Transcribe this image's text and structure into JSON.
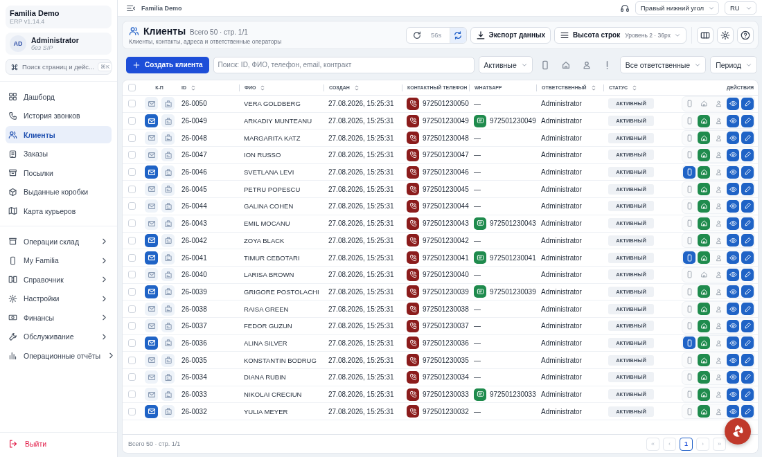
{
  "app": {
    "name": "Familia Demo",
    "version": "ERP v1.14.4"
  },
  "user": {
    "initials": "AD",
    "name": "Administrator",
    "sip": "без SIP"
  },
  "command_search": {
    "placeholder": "Поиск страниц и дейс...",
    "shortcut": "⌘K"
  },
  "nav": [
    {
      "label": "Дашборд",
      "selected": false
    },
    {
      "label": "История звонков",
      "selected": false
    },
    {
      "label": "Клиенты",
      "selected": true
    },
    {
      "label": "Заказы",
      "selected": false
    },
    {
      "label": "Посылки",
      "selected": false
    },
    {
      "label": "Выданные коробки",
      "selected": false
    },
    {
      "label": "Карта курьеров",
      "selected": false
    }
  ],
  "nav_groups": [
    {
      "label": "Операции склад",
      "expanded": false
    },
    {
      "label": "My Familia",
      "expanded": false
    },
    {
      "label": "Справочник",
      "expanded": false
    },
    {
      "label": "Настройки",
      "expanded": false
    },
    {
      "label": "Финансы",
      "expanded": false
    },
    {
      "label": "Обслуживание",
      "expanded": false
    },
    {
      "label": "Операционные отчёты",
      "expanded": false
    }
  ],
  "logout": "Выйти",
  "topbar": {
    "breadcrumb": "Familia Demo",
    "position_select": "Правый нижний угол",
    "language_select": "RU"
  },
  "header": {
    "title": "Клиенты",
    "count": "Всего 50 · стр. 1/1",
    "subtitle": "Клиенты, контакты, адреса и ответственные операторы",
    "refresh_timer": "56s",
    "auto_refresh": true,
    "export": "Экспорт данных",
    "row_height_label": "Высота строк",
    "row_height_value": "Уровень 2 · 36px"
  },
  "toolbar": {
    "create": "Создать клиента",
    "search": {
      "placeholder": "Поиск: ID, ФИО, телефон, email, контракт"
    },
    "status_filter": "Активные",
    "filters": [
      {
        "kind": "mobile",
        "on": false
      },
      {
        "kind": "home",
        "on": false
      },
      {
        "kind": "person",
        "on": false
      },
      {
        "kind": "alert",
        "on": false
      }
    ],
    "responsible_filter": "Все ответственные",
    "period": "Период"
  },
  "table": {
    "all_checked": false,
    "columns": [
      {
        "label": "К-П",
        "sortable": false
      },
      {
        "label": "ID",
        "sortable": true
      },
      {
        "label": "ФИО",
        "sortable": true
      },
      {
        "label": "СОЗДАН",
        "sortable": true
      },
      {
        "label": "КОНТАКТНЫЙ ТЕЛЕФОН",
        "sortable": false
      },
      {
        "label": "WHATSAPP",
        "sortable": false
      },
      {
        "label": "ОТВЕТСТВЕННЫЙ",
        "sortable": true
      },
      {
        "label": "СТАТУС",
        "sortable": true
      },
      {
        "label": "ДЕЙСТВИЯ",
        "sortable": false
      }
    ],
    "rows": [
      {
        "checked": false,
        "email": false,
        "id": "26-0050",
        "name": "VERA GOLDBERG",
        "created": "27.08.2026, 15:25:31",
        "phone": "972501230050",
        "whatsapp": {
          "kind": "none",
          "text": "—"
        },
        "responsible": "Administrator",
        "status": "АКТИВНЫЙ",
        "mobile_app": false,
        "home": false
      },
      {
        "checked": false,
        "email": true,
        "id": "26-0049",
        "name": "ARKADIY MUNTEANU",
        "created": "27.08.2026, 15:25:31",
        "phone": "972501230049",
        "whatsapp": {
          "kind": "number",
          "text": "972501230049"
        },
        "responsible": "Administrator",
        "status": "АКТИВНЫЙ",
        "mobile_app": false,
        "home": true
      },
      {
        "checked": false,
        "email": false,
        "id": "26-0048",
        "name": "MARGARITA KATZ",
        "created": "27.08.2026, 15:25:31",
        "phone": "972501230048",
        "whatsapp": {
          "kind": "none",
          "text": "—"
        },
        "responsible": "Administrator",
        "status": "АКТИВНЫЙ",
        "mobile_app": false,
        "home": true
      },
      {
        "checked": false,
        "email": false,
        "id": "26-0047",
        "name": "ION RUSSO",
        "created": "27.08.2026, 15:25:31",
        "phone": "972501230047",
        "whatsapp": {
          "kind": "none",
          "text": "—"
        },
        "responsible": "Administrator",
        "status": "АКТИВНЫЙ",
        "mobile_app": false,
        "home": true
      },
      {
        "checked": false,
        "email": true,
        "id": "26-0046",
        "name": "SVETLANA LEVI",
        "created": "27.08.2026, 15:25:31",
        "phone": "972501230046",
        "whatsapp": {
          "kind": "none",
          "text": "—"
        },
        "responsible": "Administrator",
        "status": "АКТИВНЫЙ",
        "mobile_app": true,
        "home": true
      },
      {
        "checked": false,
        "email": false,
        "id": "26-0045",
        "name": "PETRU POPESCU",
        "created": "27.08.2026, 15:25:31",
        "phone": "972501230045",
        "whatsapp": {
          "kind": "none",
          "text": "—"
        },
        "responsible": "Administrator",
        "status": "АКТИВНЫЙ",
        "mobile_app": false,
        "home": true
      },
      {
        "checked": false,
        "email": false,
        "id": "26-0044",
        "name": "GALINA COHEN",
        "created": "27.08.2026, 15:25:31",
        "phone": "972501230044",
        "whatsapp": {
          "kind": "none",
          "text": "—"
        },
        "responsible": "Administrator",
        "status": "АКТИВНЫЙ",
        "mobile_app": false,
        "home": true
      },
      {
        "checked": false,
        "email": false,
        "id": "26-0043",
        "name": "EMIL MOCANU",
        "created": "27.08.2026, 15:25:31",
        "phone": "972501230043",
        "whatsapp": {
          "kind": "number",
          "text": "972501230043"
        },
        "responsible": "Administrator",
        "status": "АКТИВНЫЙ",
        "mobile_app": false,
        "home": true
      },
      {
        "checked": false,
        "email": true,
        "id": "26-0042",
        "name": "ZOYA BLACK",
        "created": "27.08.2026, 15:25:31",
        "phone": "972501230042",
        "whatsapp": {
          "kind": "none",
          "text": "—"
        },
        "responsible": "Administrator",
        "status": "АКТИВНЫЙ",
        "mobile_app": false,
        "home": true
      },
      {
        "checked": false,
        "email": true,
        "id": "26-0041",
        "name": "TIMUR CEBOTARI",
        "created": "27.08.2026, 15:25:31",
        "phone": "972501230041",
        "whatsapp": {
          "kind": "number",
          "text": "972501230041"
        },
        "responsible": "Administrator",
        "status": "АКТИВНЫЙ",
        "mobile_app": true,
        "home": true
      },
      {
        "checked": false,
        "email": false,
        "id": "26-0040",
        "name": "LARISA BROWN",
        "created": "27.08.2026, 15:25:31",
        "phone": "972501230040",
        "whatsapp": {
          "kind": "none",
          "text": "—"
        },
        "responsible": "Administrator",
        "status": "АКТИВНЫЙ",
        "mobile_app": false,
        "home": false
      },
      {
        "checked": false,
        "email": true,
        "id": "26-0039",
        "name": "GRIGORE POSTOLACHI",
        "created": "27.08.2026, 15:25:31",
        "phone": "972501230039",
        "whatsapp": {
          "kind": "number",
          "text": "972501230039"
        },
        "responsible": "Administrator",
        "status": "АКТИВНЫЙ",
        "mobile_app": false,
        "home": true
      },
      {
        "checked": false,
        "email": false,
        "id": "26-0038",
        "name": "RAISA GREEN",
        "created": "27.08.2026, 15:25:31",
        "phone": "972501230038",
        "whatsapp": {
          "kind": "none",
          "text": "—"
        },
        "responsible": "Administrator",
        "status": "АКТИВНЫЙ",
        "mobile_app": false,
        "home": true
      },
      {
        "checked": false,
        "email": false,
        "id": "26-0037",
        "name": "FEDOR GUZUN",
        "created": "27.08.2026, 15:25:31",
        "phone": "972501230037",
        "whatsapp": {
          "kind": "none",
          "text": "—"
        },
        "responsible": "Administrator",
        "status": "АКТИВНЫЙ",
        "mobile_app": false,
        "home": true
      },
      {
        "checked": false,
        "email": true,
        "id": "26-0036",
        "name": "ALINA SILVER",
        "created": "27.08.2026, 15:25:31",
        "phone": "972501230036",
        "whatsapp": {
          "kind": "none",
          "text": "—"
        },
        "responsible": "Administrator",
        "status": "АКТИВНЫЙ",
        "mobile_app": true,
        "home": true
      },
      {
        "checked": false,
        "email": false,
        "id": "26-0035",
        "name": "KONSTANTIN BODRUG",
        "created": "27.08.2026, 15:25:31",
        "phone": "972501230035",
        "whatsapp": {
          "kind": "none",
          "text": "—"
        },
        "responsible": "Administrator",
        "status": "АКТИВНЫЙ",
        "mobile_app": false,
        "home": true
      },
      {
        "checked": false,
        "email": false,
        "id": "26-0034",
        "name": "DIANA RUBIN",
        "created": "27.08.2026, 15:25:31",
        "phone": "972501230034",
        "whatsapp": {
          "kind": "none",
          "text": "—"
        },
        "responsible": "Administrator",
        "status": "АКТИВНЫЙ",
        "mobile_app": false,
        "home": true
      },
      {
        "checked": false,
        "email": false,
        "id": "26-0033",
        "name": "NIKOLAI CRECIUN",
        "created": "27.08.2026, 15:25:31",
        "phone": "972501230033",
        "whatsapp": {
          "kind": "number",
          "text": "972501230033"
        },
        "responsible": "Administrator",
        "status": "АКТИВНЫЙ",
        "mobile_app": false,
        "home": true
      },
      {
        "checked": false,
        "email": true,
        "id": "26-0032",
        "name": "YULIA MEYER",
        "created": "27.08.2026, 15:25:31",
        "phone": "972501230032",
        "whatsapp": {
          "kind": "none",
          "text": "—"
        },
        "responsible": "Administrator",
        "status": "АКТИВНЫЙ",
        "mobile_app": false,
        "home": true
      }
    ]
  },
  "footer": {
    "summary": "Всего 50 · стр. 1/1",
    "pages": [
      {
        "label": "«",
        "selected": false,
        "disabled": true
      },
      {
        "label": "‹",
        "selected": false,
        "disabled": true
      },
      {
        "label": "1",
        "selected": true,
        "disabled": false
      },
      {
        "label": "›",
        "selected": false,
        "disabled": true
      },
      {
        "label": "»",
        "selected": false,
        "disabled": true
      }
    ]
  }
}
